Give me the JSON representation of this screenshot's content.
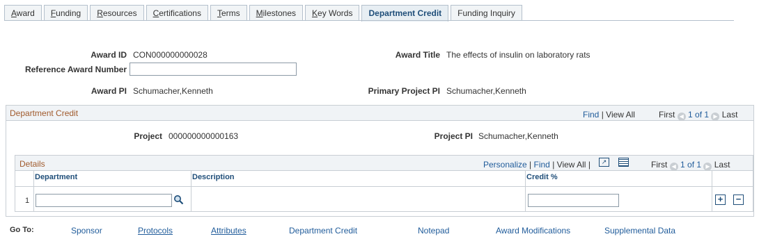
{
  "tabs": [
    {
      "label": "Award",
      "u": "A",
      "rest": "ward"
    },
    {
      "label": "Funding",
      "u": "F",
      "rest": "unding"
    },
    {
      "label": "Resources",
      "u": "R",
      "rest": "esources"
    },
    {
      "label": "Certifications",
      "u": "C",
      "rest": "ertifications"
    },
    {
      "label": "Terms",
      "u": "T",
      "rest": "erms"
    },
    {
      "label": "Milestones",
      "u": "M",
      "rest": "ilestones"
    },
    {
      "label": "Key Words",
      "u": "K",
      "rest": "ey Words"
    },
    {
      "label": "Department Credit",
      "u": "",
      "rest": "Department Credit"
    },
    {
      "label": "Funding Inquiry",
      "u": "",
      "rest": "Funding Inquiry"
    }
  ],
  "header": {
    "award_id_label": "Award ID",
    "award_id": "CON000000000028",
    "award_title_label": "Award Title",
    "award_title": "The effects of insulin on laboratory rats",
    "reference_label": "Reference Award Number",
    "reference_value": "",
    "award_pi_label": "Award PI",
    "award_pi": "Schumacher,Kenneth",
    "primary_pi_label": "Primary Project PI",
    "primary_pi": "Schumacher,Kenneth"
  },
  "dept_credit": {
    "title": "Department Credit",
    "find": "Find",
    "sep": "|",
    "view_all": "View All",
    "first": "First",
    "range": "1 of 1",
    "last": "Last",
    "project_label": "Project",
    "project": "000000000000163",
    "project_pi_label": "Project PI",
    "project_pi": "Schumacher,Kenneth"
  },
  "details": {
    "title": "Details",
    "personalize": "Personalize",
    "find": "Find",
    "view_all": "View All",
    "first": "First",
    "range": "1 of 1",
    "last": "Last",
    "columns": [
      "Department",
      "Description",
      "Credit %"
    ],
    "rows": [
      {
        "num": "1",
        "department": "",
        "description": "",
        "credit": ""
      }
    ]
  },
  "goto": {
    "label": "Go To:",
    "links": [
      "Sponsor",
      "Protocols",
      "Attributes",
      "Department Credit",
      "Notepad",
      "Award Modifications",
      "Supplemental Data"
    ]
  }
}
